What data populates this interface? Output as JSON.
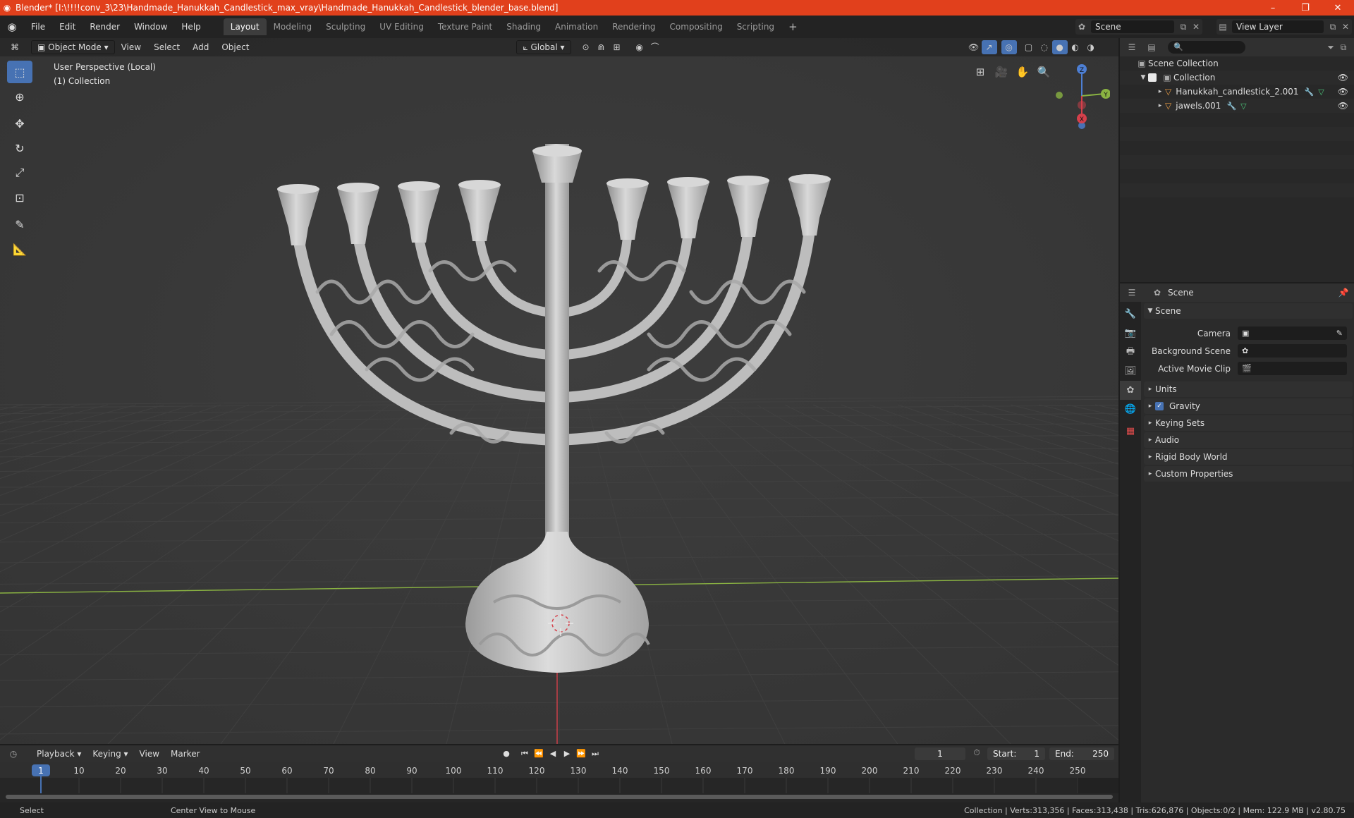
{
  "window": {
    "title": "Blender* [I:\\!!!!conv_3\\23\\Handmade_Hanukkah_Candlestick_max_vray\\Handmade_Hanukkah_Candlestick_blender_base.blend]",
    "minimize": "–",
    "maximize": "❐",
    "close": "✕"
  },
  "menu": {
    "items": [
      "File",
      "Edit",
      "Render",
      "Window",
      "Help"
    ],
    "tabs": [
      "Layout",
      "Modeling",
      "Sculpting",
      "UV Editing",
      "Texture Paint",
      "Shading",
      "Animation",
      "Rendering",
      "Compositing",
      "Scripting"
    ],
    "active_tab": "Layout",
    "add_tab": "+",
    "scene": "Scene",
    "view_layer": "View Layer"
  },
  "viewport": {
    "mode": "Object Mode",
    "menus": [
      "View",
      "Select",
      "Add",
      "Object"
    ],
    "orientation": "Global",
    "perspective": "User Perspective (Local)",
    "collection": "(1) Collection",
    "gizmo": {
      "z": "Z",
      "y": "Y",
      "x": "X"
    },
    "colors": {
      "bg": "#393939",
      "x_axis": "#d6404b",
      "y_axis": "#8ab342",
      "model": "#c8c8c8",
      "select_blue": "#4772b3"
    }
  },
  "outliner": {
    "root": "Scene Collection",
    "collection": "Collection",
    "objects": [
      "Hanukkah_candlestick_2.001",
      "jawels.001"
    ]
  },
  "properties": {
    "header": "Scene",
    "section": "Scene",
    "fields": [
      {
        "label": "Camera",
        "value": ""
      },
      {
        "label": "Background Scene",
        "value": ""
      },
      {
        "label": "Active Movie Clip",
        "value": ""
      }
    ],
    "panels": [
      "Units",
      "Gravity",
      "Keying Sets",
      "Audio",
      "Rigid Body World",
      "Custom Properties"
    ]
  },
  "timeline": {
    "menus": [
      "Playback",
      "Keying",
      "View",
      "Marker"
    ],
    "current_frame": "1",
    "start_label": "Start:",
    "start": "1",
    "end_label": "End:",
    "end": "250",
    "ticks": [
      "1",
      "10",
      "20",
      "30",
      "40",
      "50",
      "60",
      "70",
      "80",
      "90",
      "100",
      "110",
      "120",
      "130",
      "140",
      "150",
      "160",
      "170",
      "180",
      "190",
      "200",
      "210",
      "220",
      "230",
      "240",
      "250"
    ]
  },
  "status": {
    "left": "Select",
    "middle": "Center View to Mouse",
    "right": "Collection | Verts:313,356 | Faces:313,438 | Tris:626,876 | Objects:0/2 | Mem: 122.9 MB | v2.80.75"
  }
}
